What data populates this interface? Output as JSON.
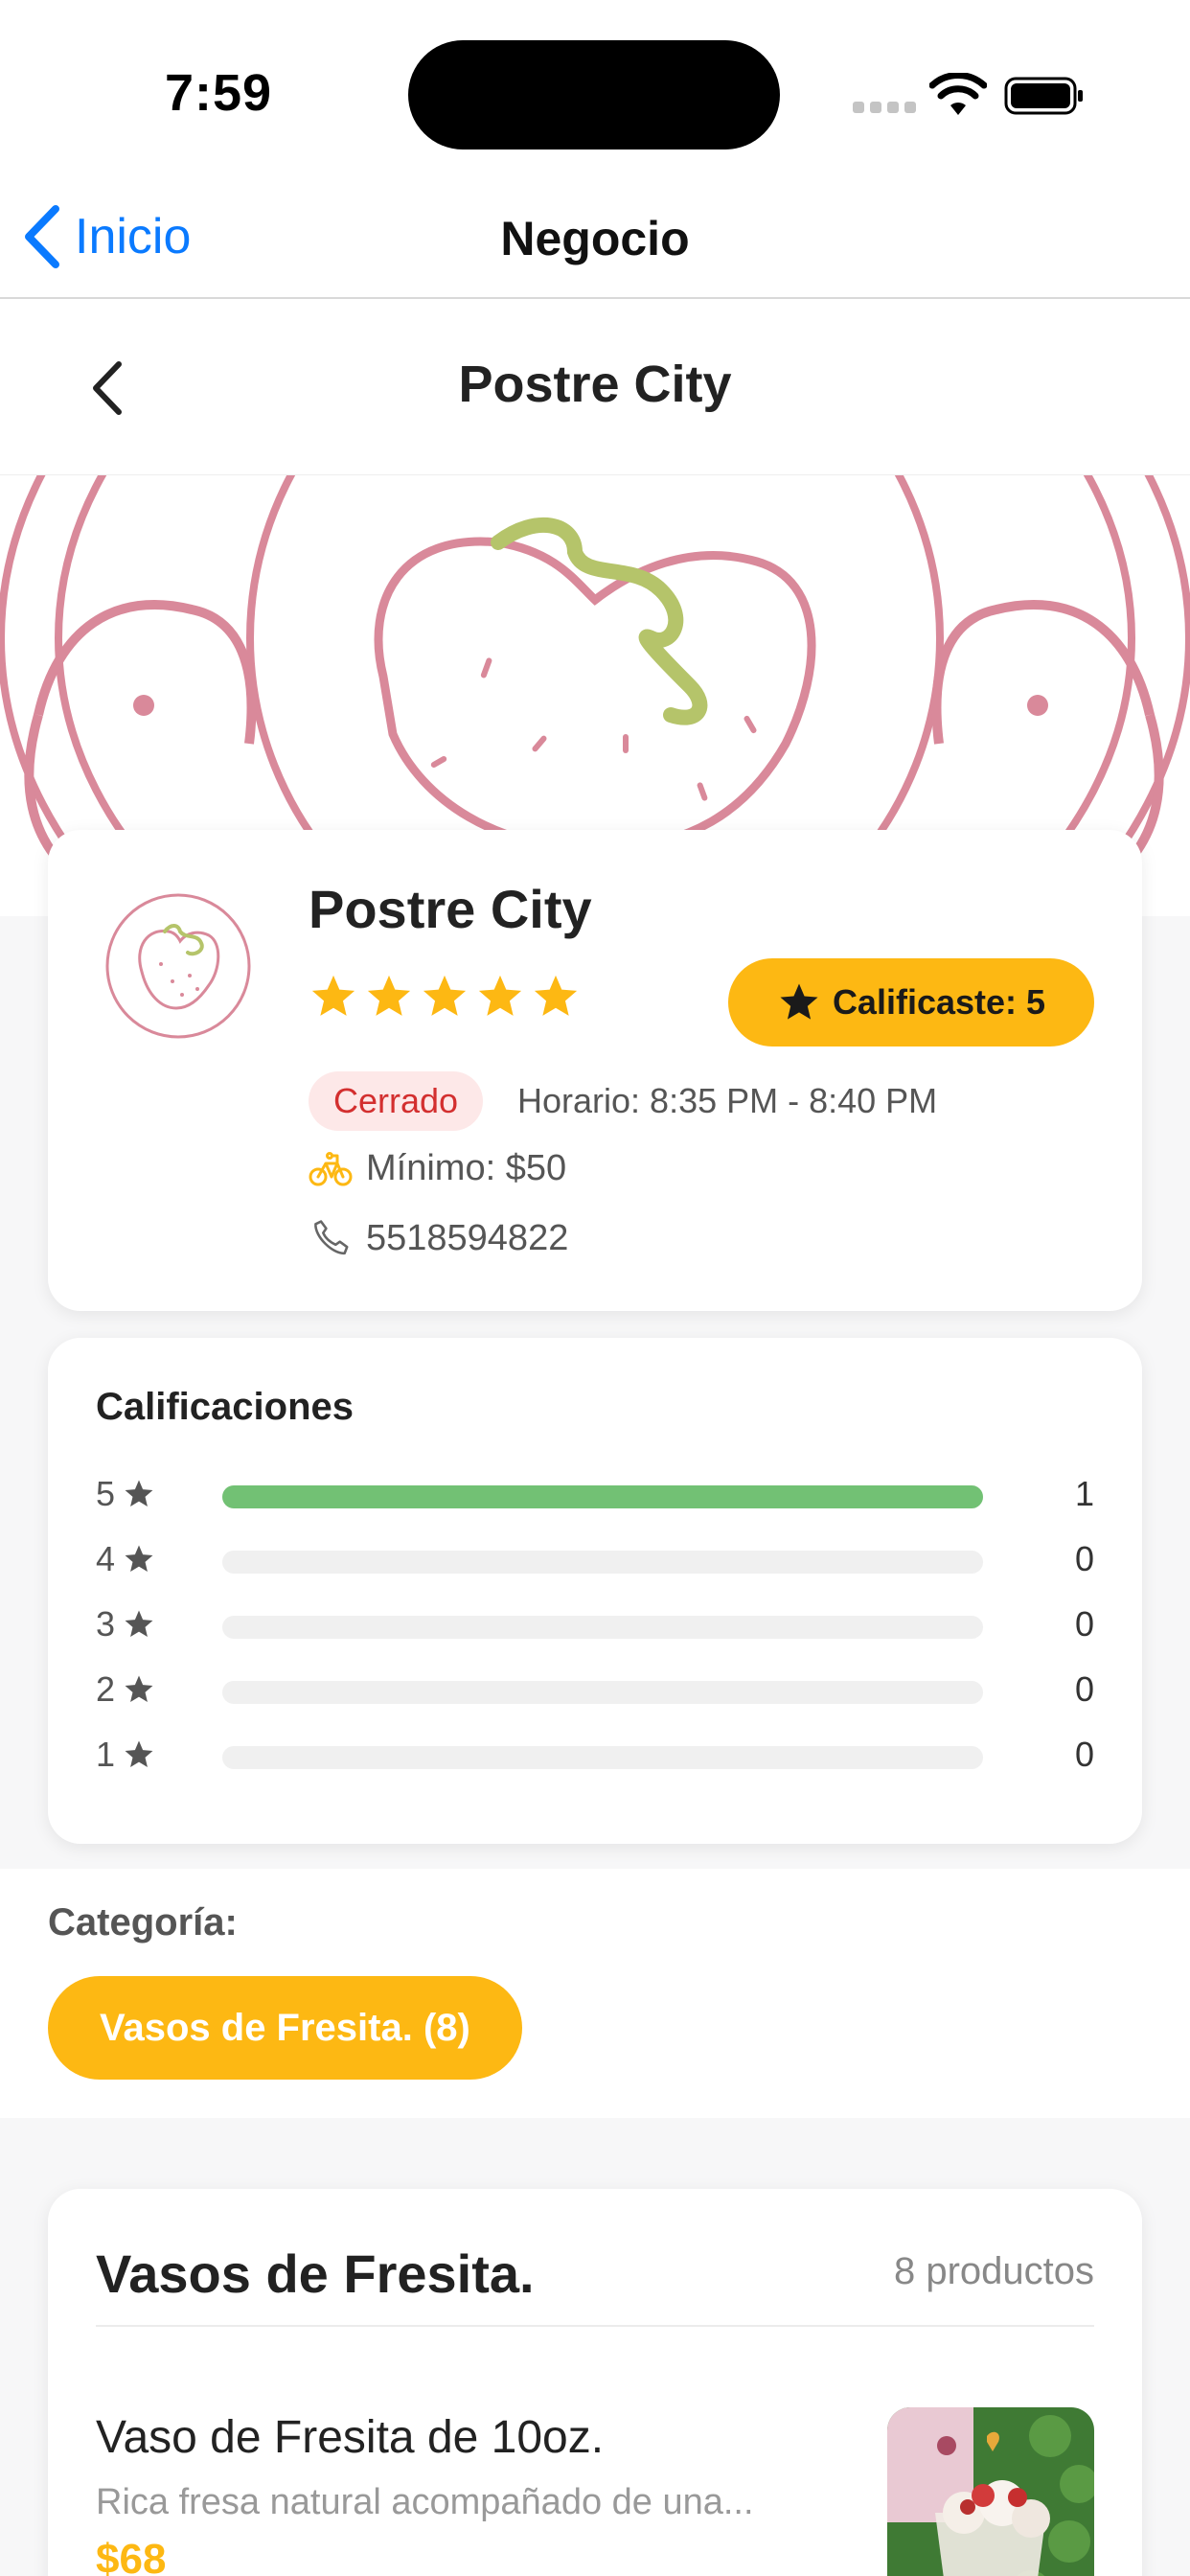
{
  "status_bar": {
    "time": "7:59"
  },
  "nav": {
    "back_label": "Inicio",
    "title": "Negocio"
  },
  "sub_header": {
    "title": "Postre City"
  },
  "business": {
    "name": "Postre City",
    "rating_stars": 5,
    "rated_label": "Calificaste: 5",
    "status": "Cerrado",
    "schedule": "Horario: 8:35 PM - 8:40 PM",
    "minimum": "Mínimo: $50",
    "phone": "5518594822"
  },
  "ratings": {
    "title": "Calificaciones",
    "rows": [
      {
        "stars": "5",
        "count": "1",
        "fraction": 1.0
      },
      {
        "stars": "4",
        "count": "0",
        "fraction": 0
      },
      {
        "stars": "3",
        "count": "0",
        "fraction": 0
      },
      {
        "stars": "2",
        "count": "0",
        "fraction": 0
      },
      {
        "stars": "1",
        "count": "0",
        "fraction": 0
      }
    ]
  },
  "category": {
    "label": "Categoría:",
    "chip": "Vasos de Fresita. (8)"
  },
  "products": {
    "section_title": "Vasos de Fresita.",
    "count_label": "8 productos",
    "items": [
      {
        "name": "Vaso de Fresita de 10oz.",
        "description": "Rica fresa natural acompañado de una...",
        "price": "$68"
      }
    ]
  },
  "colors": {
    "accent": "#fdb813",
    "link": "#0a7aff",
    "closed": "#d32f2f",
    "bar_fill": "#72c174"
  }
}
